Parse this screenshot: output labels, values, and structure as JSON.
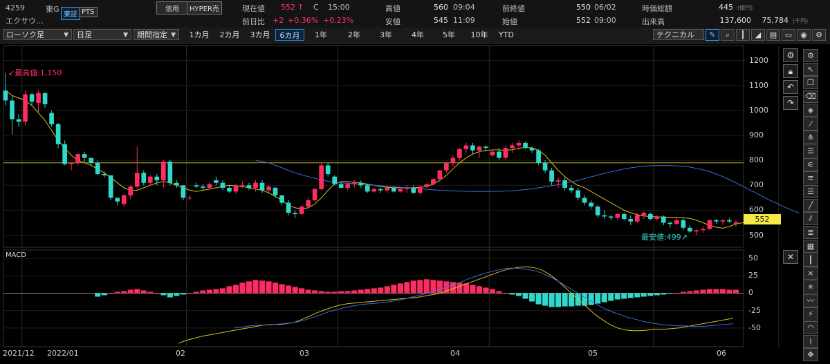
{
  "header": {
    "code": "4259",
    "market": "東G",
    "name": "エクサウ…",
    "exchanges": [
      "東証",
      "PTS"
    ],
    "tags": [
      "信用",
      "HYPER売"
    ],
    "price_label": "現在値",
    "price_value": "552",
    "price_arrow": "↑",
    "price_flag": "C",
    "price_time": "15:00",
    "change_label": "前日比",
    "change_value": "+2",
    "change_pct1": "+0.36%",
    "change_pct2": "+0.23%",
    "high_label": "高値",
    "high_value": "560",
    "high_time": "09:04",
    "low_label": "安値",
    "low_value": "545",
    "low_time": "11:09",
    "prev_close_label": "前終値",
    "prev_close_value": "550",
    "prev_close_date": "06/02",
    "open_label": "始値",
    "open_value": "552",
    "open_time": "09:00",
    "mcap_label": "時価総額",
    "mcap_value": "445",
    "mcap_unit": "(億円)",
    "volume_label": "出来高",
    "volume_value": "137,600",
    "turnover_value": "75,784",
    "turnover_unit": "(千円)"
  },
  "toolbar": {
    "chart_type": "ローソク足",
    "interval": "日足",
    "range_mode": "期間指定",
    "periods": [
      "1カ月",
      "2カ月",
      "3カ月",
      "6カ月",
      "1年",
      "2年",
      "3年",
      "4年",
      "5年",
      "10年",
      "YTD"
    ],
    "active_period": "6カ月",
    "technical_label": "テクニカル"
  },
  "chart_data": [
    {
      "type": "candlestick",
      "title": "",
      "ylim": [
        460,
        1260
      ],
      "yticks": [
        "1200",
        "1100",
        "1000",
        "900",
        "800",
        "700",
        "600",
        "500"
      ],
      "xticks": [
        "2021/12",
        "2022/01",
        "02",
        "03",
        "04",
        "05",
        "06"
      ],
      "current_price_label": "552",
      "annotations": {
        "high": "最高値:1,150",
        "low": "最安値:499"
      },
      "horizontal_line": 790,
      "candles": [
        [
          1080,
          1150,
          1020,
          1040
        ],
        [
          1040,
          1060,
          905,
          965
        ],
        [
          965,
          985,
          935,
          955
        ],
        [
          955,
          1080,
          940,
          1065
        ],
        [
          1065,
          1070,
          1020,
          1035
        ],
        [
          1030,
          1080,
          990,
          1070
        ],
        [
          1070,
          1070,
          1010,
          1025
        ],
        [
          990,
          1000,
          935,
          945
        ],
        [
          945,
          950,
          850,
          865
        ],
        [
          865,
          880,
          780,
          785
        ],
        [
          785,
          790,
          760,
          790
        ],
        [
          790,
          830,
          780,
          825
        ],
        [
          825,
          835,
          790,
          810
        ],
        [
          810,
          810,
          780,
          790
        ],
        [
          790,
          800,
          740,
          745
        ],
        [
          745,
          755,
          730,
          740
        ],
        [
          740,
          740,
          640,
          650
        ],
        [
          650,
          650,
          620,
          635
        ],
        [
          625,
          665,
          615,
          660
        ],
        [
          660,
          700,
          645,
          695
        ],
        [
          695,
          855,
          685,
          750
        ],
        [
          750,
          760,
          700,
          710
        ],
        [
          710,
          740,
          700,
          735
        ],
        [
          735,
          745,
          700,
          720
        ],
        [
          720,
          800,
          690,
          795
        ],
        [
          795,
          800,
          700,
          710
        ],
        [
          710,
          720,
          690,
          700
        ],
        [
          700,
          700,
          640,
          650
        ],
        [
          650,
          660,
          640,
          650
        ],
        [
          700,
          710,
          690,
          695
        ],
        [
          695,
          705,
          680,
          690
        ],
        [
          690,
          710,
          680,
          705
        ],
        [
          720,
          735,
          700,
          710
        ],
        [
          710,
          720,
          680,
          690
        ],
        [
          690,
          700,
          670,
          675
        ],
        [
          675,
          705,
          665,
          700
        ],
        [
          700,
          715,
          690,
          700
        ],
        [
          700,
          710,
          680,
          690
        ],
        [
          690,
          720,
          675,
          710
        ],
        [
          710,
          720,
          670,
          680
        ],
        [
          680,
          700,
          670,
          695
        ],
        [
          690,
          695,
          650,
          660
        ],
        [
          660,
          660,
          620,
          630
        ],
        [
          630,
          640,
          580,
          590
        ],
        [
          590,
          600,
          570,
          585
        ],
        [
          585,
          620,
          580,
          615
        ],
        [
          615,
          650,
          605,
          640
        ],
        [
          640,
          690,
          635,
          685
        ],
        [
          685,
          790,
          680,
          780
        ],
        [
          780,
          790,
          735,
          745
        ],
        [
          735,
          740,
          700,
          705
        ],
        [
          705,
          710,
          690,
          690
        ],
        [
          690,
          710,
          680,
          705
        ],
        [
          705,
          720,
          690,
          710
        ],
        [
          710,
          720,
          690,
          700
        ],
        [
          700,
          705,
          670,
          675
        ],
        [
          675,
          690,
          670,
          685
        ],
        [
          685,
          690,
          670,
          680
        ],
        [
          680,
          700,
          670,
          690
        ],
        [
          690,
          695,
          670,
          675
        ],
        [
          675,
          690,
          670,
          685
        ],
        [
          685,
          700,
          670,
          690
        ],
        [
          690,
          700,
          665,
          670
        ],
        [
          670,
          700,
          660,
          695
        ],
        [
          695,
          705,
          690,
          705
        ],
        [
          705,
          730,
          700,
          725
        ],
        [
          725,
          760,
          720,
          760
        ],
        [
          760,
          790,
          750,
          790
        ],
        [
          790,
          820,
          775,
          810
        ],
        [
          810,
          850,
          800,
          845
        ],
        [
          845,
          870,
          830,
          860
        ],
        [
          860,
          870,
          825,
          840
        ],
        [
          840,
          860,
          810,
          855
        ],
        [
          855,
          860,
          835,
          850
        ],
        [
          820,
          845,
          810,
          835
        ],
        [
          835,
          850,
          800,
          810
        ],
        [
          810,
          860,
          800,
          850
        ],
        [
          850,
          870,
          830,
          860
        ],
        [
          860,
          880,
          840,
          870
        ],
        [
          870,
          875,
          845,
          850
        ],
        [
          850,
          855,
          830,
          840
        ],
        [
          840,
          845,
          780,
          790
        ],
        [
          790,
          800,
          750,
          760
        ],
        [
          760,
          770,
          700,
          715
        ],
        [
          715,
          730,
          690,
          720
        ],
        [
          720,
          730,
          680,
          690
        ],
        [
          690,
          700,
          670,
          680
        ],
        [
          680,
          690,
          640,
          650
        ],
        [
          650,
          660,
          620,
          630
        ],
        [
          630,
          640,
          605,
          615
        ],
        [
          615,
          620,
          570,
          580
        ],
        [
          580,
          600,
          565,
          575
        ],
        [
          575,
          580,
          560,
          570
        ],
        [
          570,
          590,
          560,
          585
        ],
        [
          585,
          590,
          560,
          565
        ],
        [
          565,
          580,
          540,
          555
        ],
        [
          555,
          590,
          550,
          580
        ],
        [
          580,
          595,
          565,
          590
        ],
        [
          585,
          590,
          560,
          565
        ],
        [
          565,
          580,
          560,
          575
        ],
        [
          575,
          580,
          540,
          550
        ],
        [
          550,
          555,
          530,
          545
        ],
        [
          545,
          570,
          540,
          560
        ],
        [
          560,
          570,
          520,
          530
        ],
        [
          530,
          540,
          510,
          515
        ],
        [
          515,
          525,
          500,
          520
        ],
        [
          520,
          535,
          510,
          525
        ],
        [
          525,
          565,
          520,
          560
        ],
        [
          560,
          565,
          545,
          555
        ],
        [
          555,
          565,
          540,
          560
        ],
        [
          560,
          570,
          550,
          555
        ],
        [
          545,
          560,
          535,
          552
        ]
      ],
      "series": [
        {
          "values": [
            1080,
            1060,
            1050,
            1040,
            1020,
            990,
            960,
            920,
            880,
            850,
            820,
            800,
            790,
            780,
            765,
            750,
            730,
            710,
            690,
            680,
            680,
            690,
            700,
            710,
            715,
            710,
            700,
            690,
            680,
            675,
            680,
            685,
            690,
            695,
            700,
            698,
            695,
            690,
            685,
            680,
            670,
            655,
            640,
            620,
            610,
            605,
            610,
            625,
            650,
            680,
            705,
            715,
            715,
            712,
            710,
            705,
            700,
            695,
            692,
            690,
            690,
            690,
            690,
            692,
            695,
            705,
            720,
            740,
            765,
            790,
            810,
            825,
            835,
            840,
            842,
            842,
            840,
            843,
            848,
            852,
            850,
            840,
            820,
            790,
            760,
            735,
            715,
            700,
            690,
            675,
            660,
            645,
            630,
            615,
            600,
            590,
            582,
            577,
            575,
            574,
            572,
            572,
            571,
            570,
            567,
            560,
            550,
            540,
            532,
            528,
            535,
            545,
            550,
            553,
            555
          ]
        },
        {
          "start": 38,
          "values": [
            800,
            795,
            790,
            780,
            770,
            760,
            750,
            742,
            735,
            728,
            722,
            716,
            712,
            710,
            708,
            706,
            704,
            702,
            700,
            698,
            696,
            694,
            692,
            690,
            688,
            686,
            684,
            682,
            680,
            679,
            678,
            677,
            676,
            675,
            675,
            675,
            676,
            676,
            677,
            678,
            680,
            683,
            686,
            690,
            694,
            698,
            703,
            708,
            714,
            720,
            727,
            734,
            741,
            748,
            754,
            760,
            766,
            770,
            774,
            777,
            778,
            779,
            779,
            779,
            778,
            776,
            773,
            768,
            762,
            755,
            745,
            735,
            723,
            710,
            697,
            683,
            670,
            656,
            642,
            630,
            617,
            606,
            595,
            586,
            578,
            572
          ]
        },
        {
          "start": 125,
          "values": [
            750,
            745,
            742,
            739,
            736,
            733,
            730,
            727,
            724,
            721,
            718,
            715,
            712,
            709,
            706,
            703,
            700,
            698,
            696,
            694,
            692,
            690,
            688,
            686,
            684,
            682,
            680
          ]
        }
      ]
    },
    {
      "type": "macd",
      "title": "MACD",
      "ylim": [
        -75,
        62
      ],
      "yticks": [
        "50",
        "25",
        "0",
        "-25",
        "-50"
      ],
      "histogram": [
        -5,
        -3,
        0,
        2,
        3,
        5,
        6,
        4,
        2,
        0,
        -3,
        -6,
        -4,
        -2,
        0,
        2,
        4,
        5,
        6,
        7,
        10,
        12,
        15,
        17,
        19,
        18,
        17,
        15,
        13,
        11,
        9,
        7,
        5,
        4,
        3,
        2,
        2,
        3,
        3,
        4,
        5,
        6,
        7,
        8,
        10,
        12,
        14,
        16,
        18,
        19,
        20,
        19,
        18,
        17,
        16,
        15,
        14,
        12,
        10,
        8,
        6,
        3,
        0,
        -2,
        -4,
        -8,
        -12,
        -16,
        -18,
        -20,
        -20,
        -19,
        -19,
        -18,
        -18,
        -17,
        -15,
        -13,
        -11,
        -9,
        -8,
        -7,
        -6,
        -5,
        -4,
        -3,
        -2,
        -1,
        0,
        2,
        3,
        4,
        5,
        6,
        6,
        6,
        5,
        5
      ],
      "series": [
        {
          "color": "#d8c21a",
          "values": [
            -72,
            -68,
            -65,
            -62,
            -60,
            -58,
            -56,
            -54,
            -52,
            -50,
            -48,
            -46,
            -45,
            -45,
            -44,
            -42,
            -38,
            -33,
            -28,
            -24,
            -20,
            -17,
            -15,
            -14,
            -13,
            -12,
            -11,
            -10,
            -9,
            -8,
            -7,
            -6,
            -4,
            -2,
            0,
            4,
            8,
            12,
            16,
            20,
            24,
            28,
            32,
            35,
            37,
            38,
            37,
            34,
            28,
            20,
            10,
            0,
            -10,
            -20,
            -30,
            -38,
            -45,
            -50,
            -53,
            -54,
            -54,
            -53,
            -52,
            -52,
            -51,
            -50,
            -48,
            -46,
            -44,
            -42,
            -40,
            -38,
            -36
          ]
        },
        {
          "color": "#3a6edc",
          "values": [
            -50,
            -49,
            -47,
            -46,
            -46,
            -45,
            -44,
            -43,
            -41,
            -38,
            -34,
            -30,
            -26,
            -23,
            -20,
            -18,
            -16,
            -15,
            -14,
            -13,
            -11,
            -9,
            -6,
            -3,
            0,
            3,
            7,
            11,
            15,
            20,
            24,
            28,
            31,
            34,
            36,
            36,
            35,
            33,
            30,
            25,
            19,
            12,
            5,
            -2,
            -9,
            -16,
            -22,
            -27,
            -31,
            -35,
            -38,
            -41,
            -43,
            -45,
            -46,
            -47,
            -47,
            -48,
            -48,
            -47,
            -46,
            -45,
            -44
          ]
        }
      ]
    }
  ],
  "toggle_labels": {
    "macd_close": "✕"
  }
}
